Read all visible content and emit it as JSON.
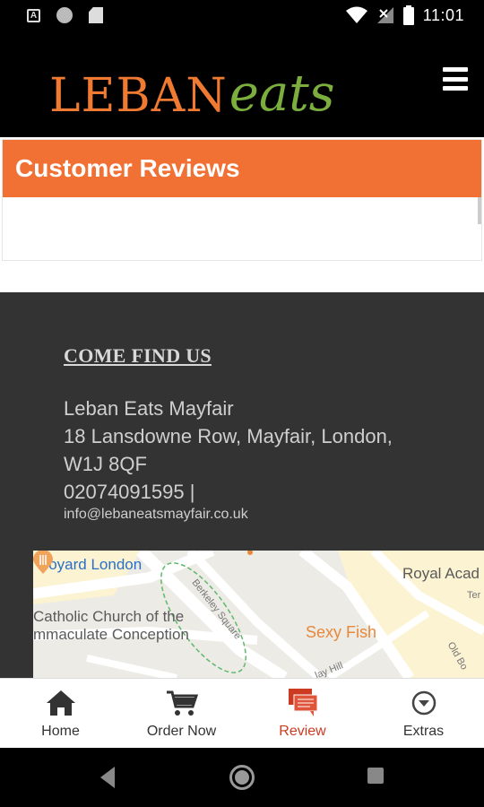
{
  "status_bar": {
    "time": "11:01",
    "left_icons": [
      "accessibility-a-icon",
      "circle-notification-icon",
      "sd-card-icon"
    ],
    "right_icons": [
      "wifi-icon",
      "no-signal-icon",
      "battery-icon"
    ]
  },
  "header": {
    "logo_part1": "LEBAN",
    "logo_part2": "eats",
    "menu_icon": "hamburger-menu-icon",
    "brand_orange": "#f07a32",
    "brand_green": "#7cae3e"
  },
  "reviews": {
    "title": "Customer Reviews",
    "accent": "#f07133"
  },
  "footer": {
    "heading": "COME FIND US",
    "address_lines": [
      "Leban Eats Mayfair",
      "18 Lansdowne Row,  Mayfair, London,",
      "W1J 8QF",
      "02074091595 |"
    ],
    "email": "info@lebaneatsmayfair.co.uk",
    "background": "#333333"
  },
  "map": {
    "labels": {
      "goyard": "Goyard London",
      "royal": "Royal Acad",
      "church1": "Catholic Church of the",
      "church2": "mmaculate Conception",
      "sexy_fish": "Sexy Fish",
      "berkeley": "Berkeley Square",
      "hill": "lay Hill",
      "old_bond": "Old Bo",
      "ter": "Ter"
    }
  },
  "bottom_nav": {
    "items": [
      {
        "label": "Home",
        "icon": "home-icon"
      },
      {
        "label": "Order Now",
        "icon": "cart-icon"
      },
      {
        "label": "Review",
        "icon": "review-chat-icon"
      },
      {
        "label": "Extras",
        "icon": "chevron-circle-down-icon"
      }
    ],
    "active_index": 2,
    "active_color": "#cc3a22"
  },
  "android_nav": {
    "buttons": [
      "back-icon",
      "home-circle-icon",
      "recents-square-icon"
    ]
  }
}
